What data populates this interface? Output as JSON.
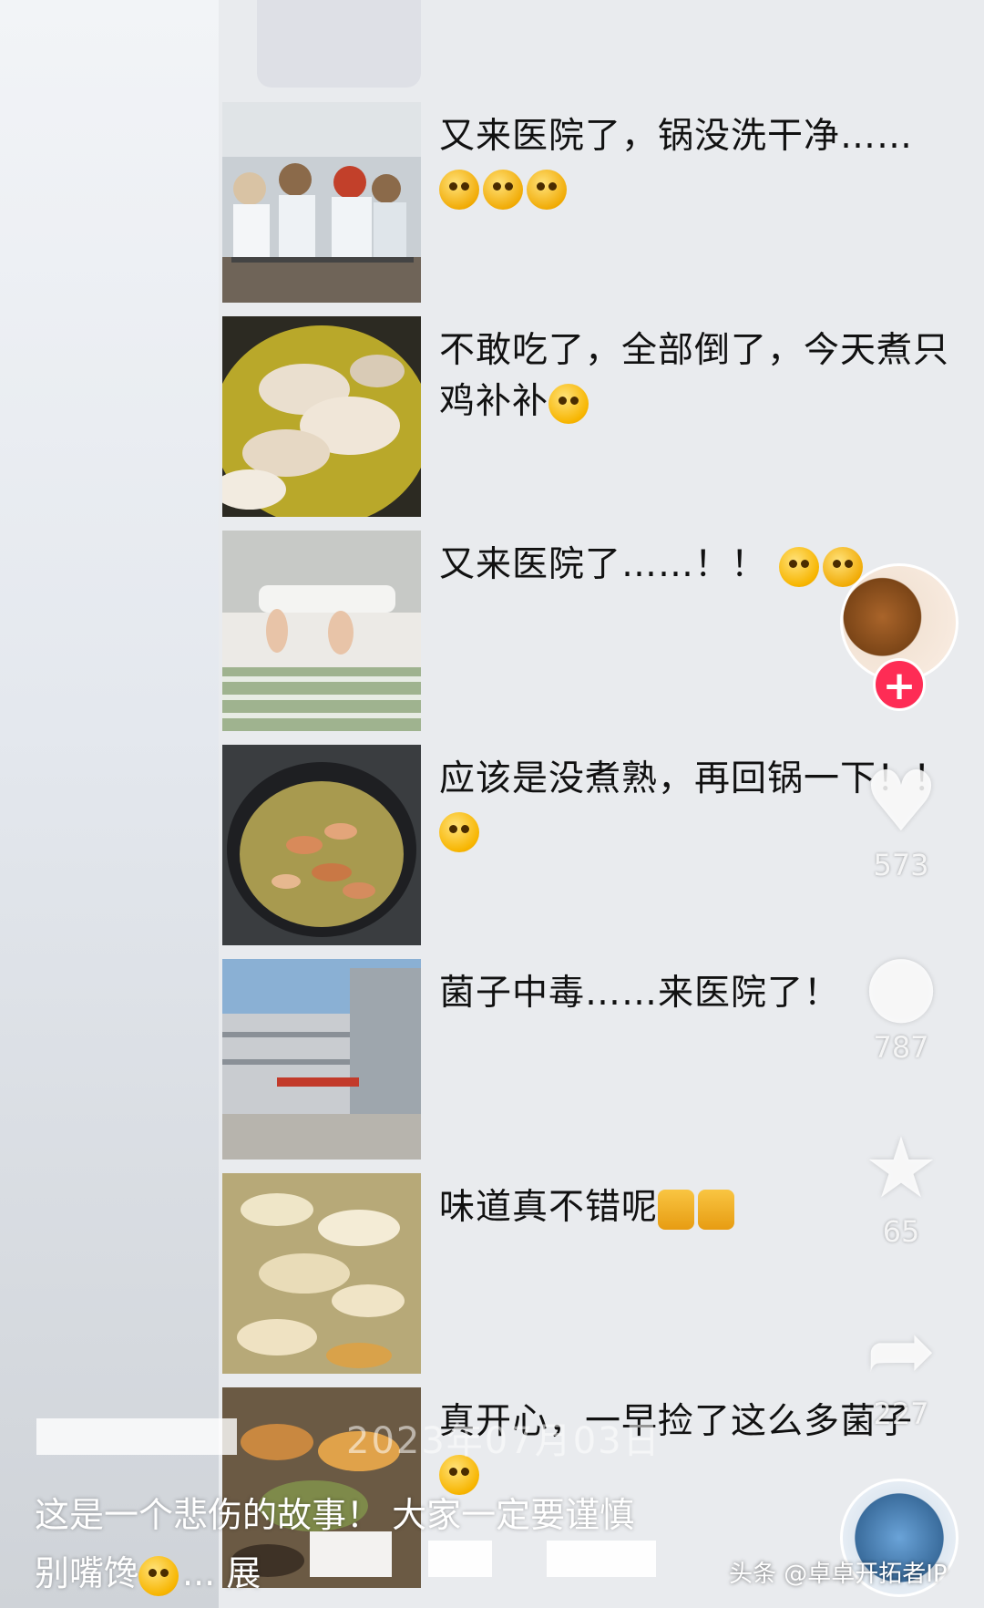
{
  "posts": [
    {
      "text": "又来医院了，锅没洗干净……",
      "emojis": [
        "cry-icon",
        "cry-icon",
        "sob-icon"
      ],
      "thumb": "doctors-photo"
    },
    {
      "text": "不敢吃了，全部倒了，今天煮只鸡补补",
      "emojis": [
        "grin-icon"
      ],
      "thumb": "chicken-soup-photo"
    },
    {
      "text": "又来医院了……！！",
      "emojis": [
        "angry-icon",
        "sob-icon"
      ],
      "thumb": "hospital-bed-photo"
    },
    {
      "text": "应该是没煮熟，再回锅一下！！",
      "emojis": [
        "shush-icon"
      ],
      "thumb": "mushroom-wok-photo"
    },
    {
      "text": "菌子中毒……来医院了！",
      "emojis": [
        "shock-icon"
      ],
      "thumb": "hospital-building-photo"
    },
    {
      "text": "味道真不错呢",
      "emojis": [
        "thumbs-up-icon",
        "thumbs-up-icon"
      ],
      "thumb": "mushroom-dish-photo"
    },
    {
      "text": "真开心，一早捡了这么多菌子",
      "emojis": [
        "grin-icon"
      ],
      "thumb": "mushroom-basket-photo"
    }
  ],
  "actions": {
    "like_count": "573",
    "comment_count": "787",
    "favorite_count": "65",
    "share_count": "227"
  },
  "follow_label": "+",
  "date_stamp": "2023年07月03日",
  "caption": {
    "line1": "这是一个悲伤的故事！ 大家一定要谨慎",
    "line2": "别嘴馋",
    "more": "展"
  },
  "watermark": "头条 @卓卓开拓者IP",
  "colors": {
    "accent": "#fe2c55",
    "text": "#111111"
  }
}
